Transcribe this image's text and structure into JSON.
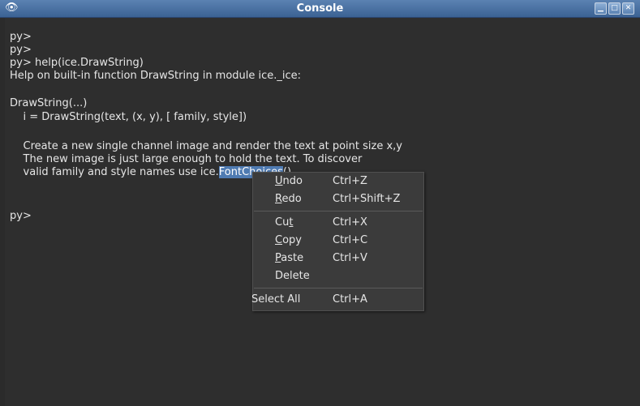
{
  "window": {
    "title": "Console",
    "icon": "eye-icon",
    "controls": [
      "minimize-icon",
      "maximize-icon",
      "close-icon"
    ],
    "colors": {
      "titlebar": "#4a72a2",
      "background": "#2e2e2e",
      "text": "#e6e6e6",
      "selection": "#4f7bb2"
    }
  },
  "console": {
    "lines": [
      "py>",
      "py>",
      "py> help(ice.DrawString)",
      "Help on built-in function DrawString in module ice._ice:",
      "",
      "DrawString(...)",
      "    i = DrawString(text, (x, y), [ family, style])",
      "",
      "    Create a new single channel image and render the text at point size x,y",
      "    The new image is just large enough to hold the text. To discover",
      "    valid family and style names use ice.",
      "",
      "",
      "py>"
    ],
    "selected_text": "FontChoices",
    "after_selection": "()"
  },
  "context_menu": {
    "items": [
      {
        "label_pre": "",
        "label_u": "U",
        "label_post": "ndo",
        "shortcut": "Ctrl+Z"
      },
      {
        "label_pre": "",
        "label_u": "R",
        "label_post": "edo",
        "shortcut": "Ctrl+Shift+Z"
      },
      {
        "label_pre": "Cu",
        "label_u": "t",
        "label_post": "",
        "shortcut": "Ctrl+X"
      },
      {
        "label_pre": "",
        "label_u": "C",
        "label_post": "opy",
        "shortcut": "Ctrl+C"
      },
      {
        "label_pre": "",
        "label_u": "P",
        "label_post": "aste",
        "shortcut": "Ctrl+V"
      },
      {
        "label_pre": "Delete",
        "label_u": "",
        "label_post": "",
        "shortcut": ""
      },
      {
        "label_pre": "Select All",
        "label_u": "",
        "label_post": "",
        "shortcut": "Ctrl+A"
      }
    ]
  }
}
